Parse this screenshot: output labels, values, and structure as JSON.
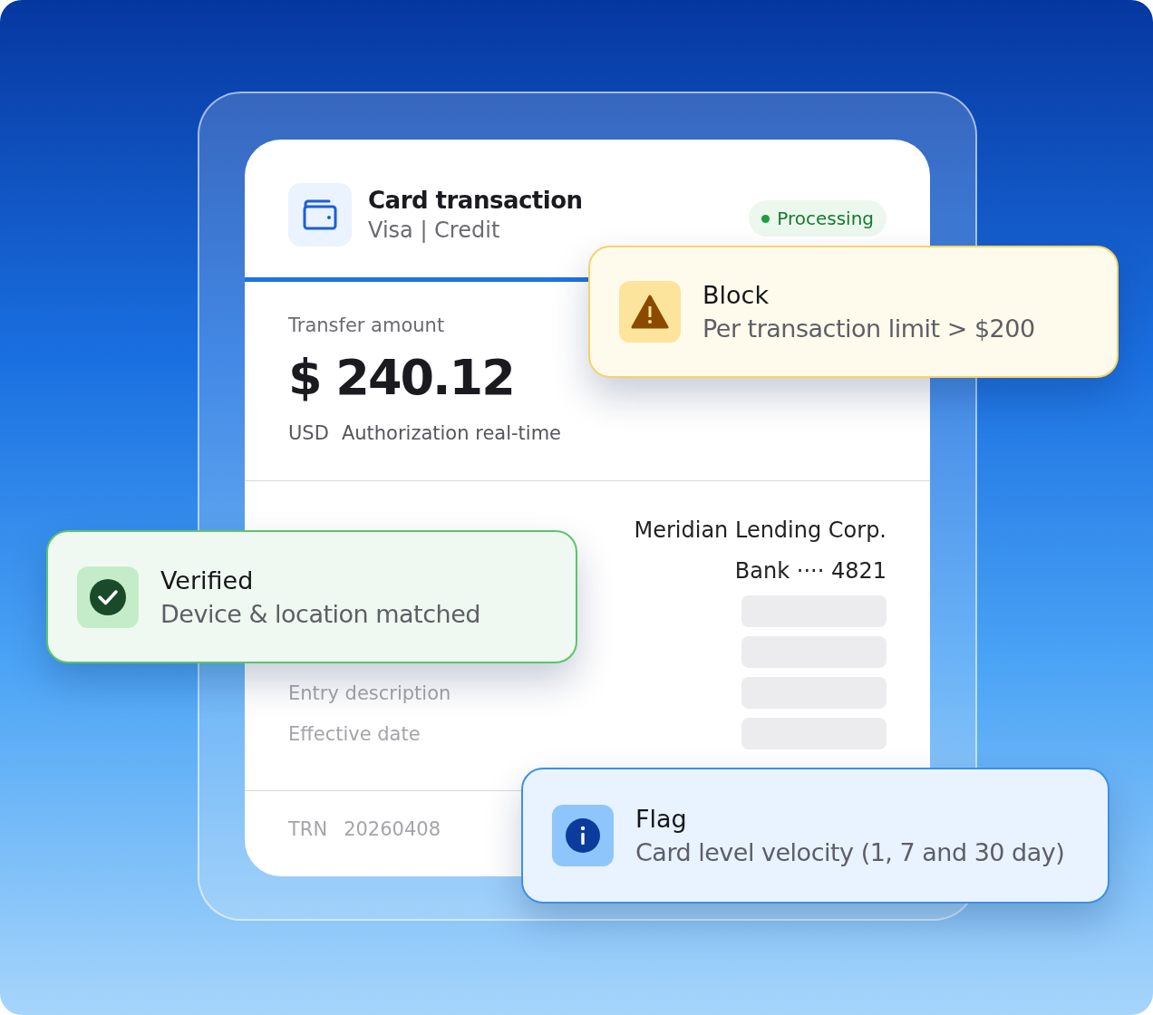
{
  "card": {
    "title": "Card transaction",
    "subtitle": "Visa | Credit",
    "status": {
      "label": "Processing",
      "color": "#1e9e3e"
    },
    "amount_label": "Transfer amount",
    "amount": "$ 240.12",
    "currency": "USD",
    "mode": "Authorization real-time",
    "details": [
      {
        "value": "Meridian Lending Corp.",
        "kind": "text"
      },
      {
        "value": "Bank ···· 4821",
        "kind": "text"
      },
      {
        "kind": "skeleton"
      },
      {
        "kind": "skeleton"
      },
      {
        "label": "Entry description",
        "kind": "skeleton"
      },
      {
        "label": "Effective date",
        "kind": "skeleton"
      }
    ],
    "footer": {
      "label": "TRN",
      "value": "20260408"
    }
  },
  "alerts": [
    {
      "kind": "block",
      "title": "Block",
      "text": "Per transaction limit > $200"
    },
    {
      "kind": "verified",
      "title": "Verified",
      "text": "Device & location matched"
    },
    {
      "kind": "flag",
      "title": "Flag",
      "text": "Card level velocity (1, 7 and 30 day)"
    }
  ]
}
